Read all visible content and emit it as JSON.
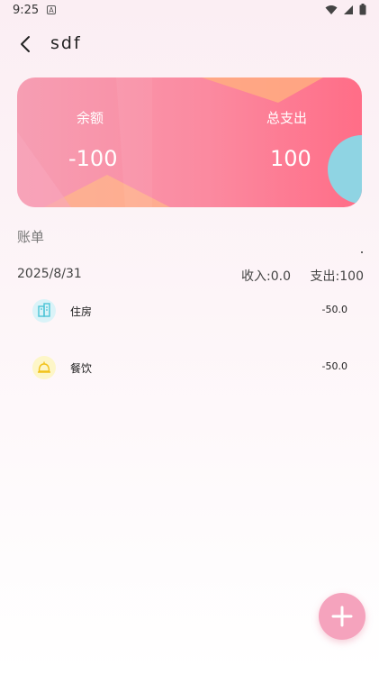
{
  "status_bar": {
    "time": "9:25",
    "a_icon": "A"
  },
  "header": {
    "title": "sdf"
  },
  "summary": {
    "balance_label": "余额",
    "balance_value": "-100",
    "expense_label": "总支出",
    "expense_value": "100"
  },
  "section_title": "账单",
  "group": {
    "date": "2025/8/31",
    "income": "收入:0.0",
    "expense": "支出:100"
  },
  "bills": [
    {
      "name": "住房",
      "amount": "-50.0",
      "icon": "building-icon",
      "color": "#4cc3d6"
    },
    {
      "name": "餐饮",
      "amount": "-50.0",
      "icon": "dome-food-icon",
      "color": "#f2d13a"
    }
  ],
  "colors": {
    "card_start": "#f69eb3",
    "card_end": "#ff6d87",
    "fab": "#f5a3bd",
    "accent_teal": "#8fd4e3"
  }
}
